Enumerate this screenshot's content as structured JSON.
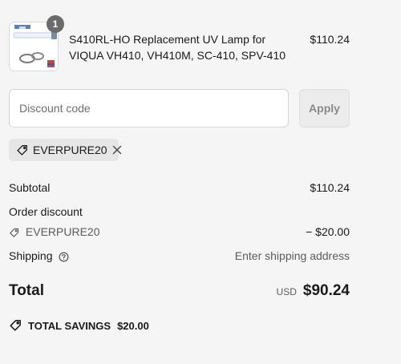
{
  "product": {
    "title": "S410RL-HO Replacement UV Lamp for VIQUA VH410, VH410M, SC-410, SPV-410",
    "price": "$110.24",
    "quantity": "1",
    "image_icon": "uv-lamp-product-image"
  },
  "discount": {
    "placeholder": "Discount code",
    "value": "",
    "apply_label": "Apply",
    "applied_code": "EVERPURE20"
  },
  "summary": {
    "subtotal_label": "Subtotal",
    "subtotal_value": "$110.24",
    "order_discount_label": "Order discount",
    "discount_code": "EVERPURE20",
    "discount_value": "− $20.00",
    "shipping_label": "Shipping",
    "shipping_value": "Enter shipping address",
    "total_label": "Total",
    "currency": "USD",
    "total_value": "$90.24",
    "savings_label": "TOTAL SAVINGS",
    "savings_value": "$20.00"
  },
  "colors": {
    "background": "#f5f5f5",
    "badge": "#6b6b6b",
    "muted_text": "#5c5c5c"
  }
}
